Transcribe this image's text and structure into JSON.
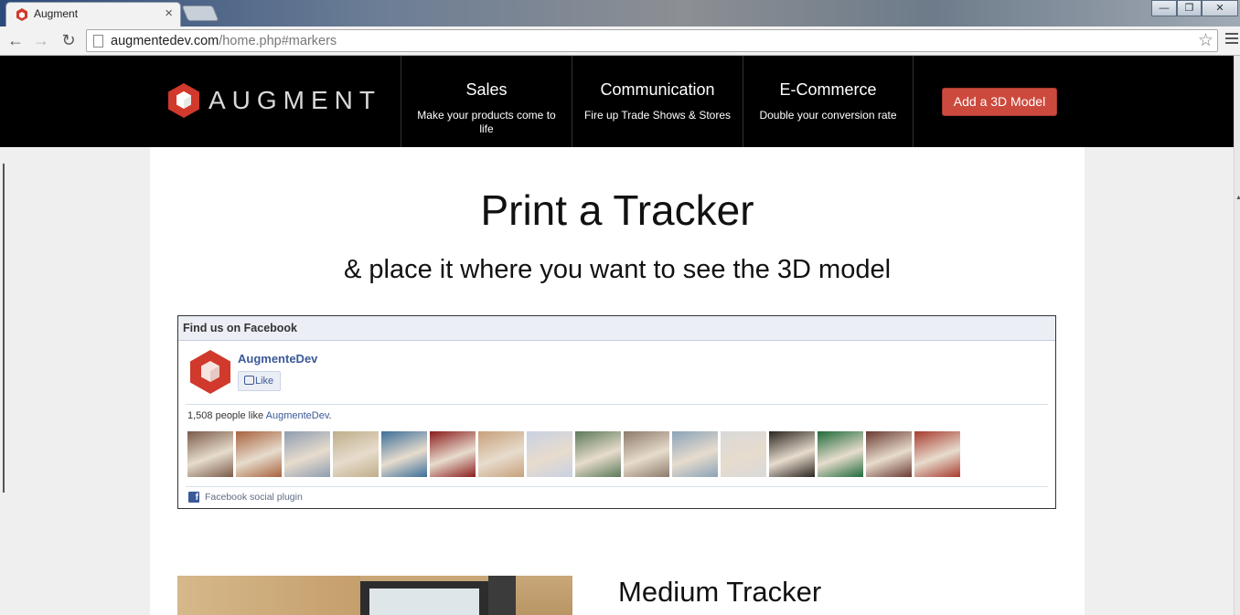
{
  "browser": {
    "tab_title": "Augment",
    "tab_close": "×",
    "url_host": "augmentedev.com",
    "url_path": "/home.php#markers",
    "window_controls": [
      "—",
      "❐",
      "✕"
    ]
  },
  "header": {
    "logo_text": "AUGMENT",
    "nav": [
      {
        "title": "Sales",
        "subtitle": "Make your products come to life"
      },
      {
        "title": "Communication",
        "subtitle": "Fire up Trade Shows & Stores"
      },
      {
        "title": "E-Commerce",
        "subtitle": "Double your conversion rate"
      }
    ],
    "cta_label": "Add a 3D Model"
  },
  "main": {
    "title": "Print a Tracker",
    "subtitle": "& place it where you want to see the 3D model",
    "section_title": "Medium Tracker"
  },
  "facebook": {
    "header": "Find us on Facebook",
    "page_name": "AugmenteDev",
    "like_label": "Like",
    "count_text": "1,508 people like ",
    "count_link": "AugmenteDev",
    "count_end": ".",
    "plugin_label": "Facebook social plugin",
    "faces": [
      "#7a5a48",
      "#a8623d",
      "#8f9db0",
      "#bfae8a",
      "#3b6f9a",
      "#8b1d1d",
      "#c7a07b",
      "#c9d1e3",
      "#5b7a58",
      "#8d7a6a",
      "#8aa3b8",
      "#d9d9d9",
      "#2a2520",
      "#1f6b3a",
      "#6b3a32",
      "#a73b2f"
    ]
  },
  "colors": {
    "brand_red": "#cc4a3d",
    "header_bg": "#000000",
    "facebook_blue": "#3b5998"
  }
}
